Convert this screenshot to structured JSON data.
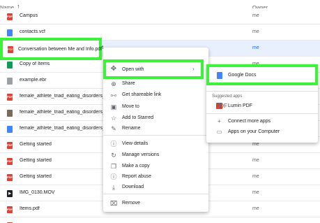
{
  "header": {
    "name_label": "Name",
    "sort_icon": "arrow-up-icon",
    "owner_label": "Owner"
  },
  "files": [
    {
      "name": "Campus",
      "owner": "me",
      "type": "pdf"
    },
    {
      "name": "contacts.vcf",
      "owner": "me",
      "type": "doc"
    },
    {
      "name": "Conversation between Me and Info.pdf",
      "owner": "me",
      "type": "pdf"
    },
    {
      "name": "Copy of Items",
      "owner": "me",
      "type": "sheet"
    },
    {
      "name": "example.ebr",
      "owner": "me",
      "type": "file"
    },
    {
      "name": "female_athlete_triad_eating_disorders_hav",
      "owner": "me",
      "type": "pdf"
    },
    {
      "name": "female_athlete_triad_eating_disorders_hav",
      "owner": "me",
      "type": "img"
    },
    {
      "name": "female_athlete_triad_eating_disorders_hav",
      "owner": "me",
      "type": "doc"
    },
    {
      "name": "Getting started",
      "owner": "me",
      "type": "pdf"
    },
    {
      "name": "Getting started",
      "owner": "me",
      "type": "pdf"
    },
    {
      "name": "Getting started",
      "owner": "me",
      "type": "pdf"
    },
    {
      "name": "IMG_0130.MOV",
      "owner": "me",
      "type": "vid"
    },
    {
      "name": "Items.pdf",
      "owner": "me",
      "type": "pdf"
    },
    {
      "name": "",
      "owner": "me",
      "type": "pdf"
    }
  ],
  "selected_file": {
    "name": "Conversation between Me and Info.pdf",
    "icon": "pdf-file-icon"
  },
  "context_menu": {
    "open_with": {
      "label": "Open with",
      "icon": "move-arrows-icon",
      "arrow": "›"
    },
    "items": [
      {
        "label": "Share",
        "icon": "share-icon",
        "glyph": "⊕"
      },
      {
        "label": "Get shareable link",
        "icon": "link-icon",
        "glyph": "⧟"
      },
      {
        "label": "Move to",
        "icon": "folder-move-icon",
        "glyph": "▣"
      },
      {
        "label": "Add to Starred",
        "icon": "star-icon",
        "glyph": "☆"
      },
      {
        "label": "Rename",
        "icon": "pencil-icon",
        "glyph": "✎"
      },
      {
        "label": "View details",
        "icon": "info-icon",
        "glyph": "ⓘ"
      },
      {
        "label": "Manage versions",
        "icon": "history-icon",
        "glyph": "↻"
      },
      {
        "label": "Make a copy",
        "icon": "copy-icon",
        "glyph": "❐"
      },
      {
        "label": "Report abuse",
        "icon": "report-icon",
        "glyph": "ⓘ"
      },
      {
        "label": "Download",
        "icon": "download-icon",
        "glyph": "⤓"
      },
      {
        "label": "Remove",
        "icon": "trash-icon",
        "glyph": "⌧"
      }
    ]
  },
  "submenu": {
    "google_docs": {
      "label": "Google Docs",
      "icon": "google-docs-icon"
    },
    "suggested_label": "Suggested apps",
    "lumin": {
      "label": "Lumin PDF",
      "icon": "lumin-pdf-icon",
      "glyph": "PDF"
    },
    "connect": {
      "label": "Connect more apps",
      "icon": "plus-icon",
      "glyph": "+"
    },
    "computer": {
      "label": "Apps on your Computer",
      "icon": "laptop-icon",
      "glyph": "▭"
    }
  },
  "colors": {
    "highlight": "#3ef23b",
    "selected_row": "#e8f0fe",
    "owner_selected": "#1967d2"
  }
}
